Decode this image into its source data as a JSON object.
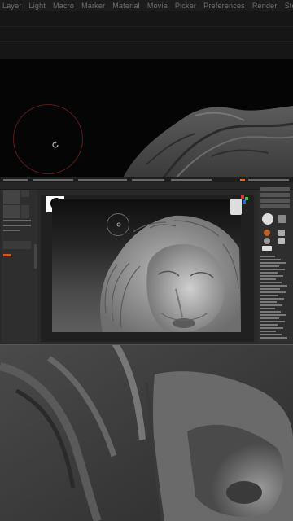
{
  "menu": {
    "items": [
      "Layer",
      "Light",
      "Macro",
      "Marker",
      "Material",
      "Movie",
      "Picker",
      "Preferences",
      "Render",
      "Stencil",
      "St"
    ]
  },
  "canvas": {
    "brush_cursor": "brush-radius-ring",
    "rotate_icon": "rotate-icon"
  },
  "embedded_window": {
    "subject": "lion-head-sculpt",
    "right_panel_items": [
      "",
      "",
      "",
      "",
      "",
      "",
      "",
      "",
      "",
      "",
      "",
      "",
      "",
      "",
      "",
      "",
      "",
      "",
      "",
      "",
      "",
      "",
      "",
      "",
      "",
      ""
    ]
  },
  "colors": {
    "menubar": "#1c1c1c",
    "brush_ring": "#5a1c1c",
    "accent_orange": "#e07020"
  }
}
